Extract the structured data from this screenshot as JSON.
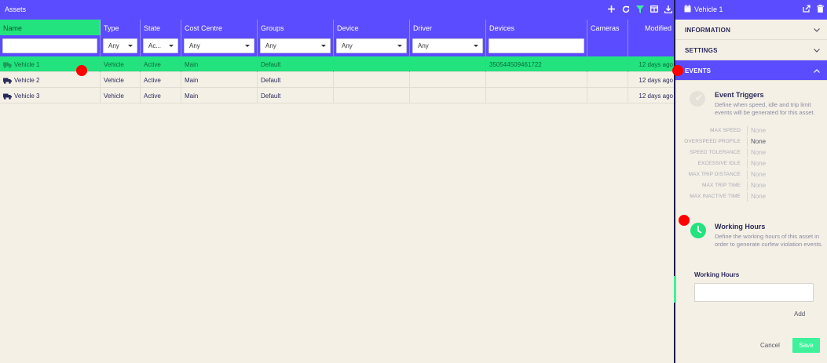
{
  "assets": {
    "title": "Assets",
    "columns": [
      "Name",
      "Type",
      "State",
      "Cost Centre",
      "Groups",
      "Device",
      "Driver",
      "Devices",
      "Cameras",
      "Modified"
    ],
    "filters": {
      "type": "Any",
      "state": "Ac...",
      "cost_centre": "Any",
      "groups": "Any",
      "device": "Any",
      "driver": "Any"
    },
    "rows": [
      {
        "name": "Vehicle 1",
        "type": "Vehicle",
        "state": "Active",
        "cost_centre": "Main",
        "groups": "Default",
        "device": "",
        "driver": "",
        "devices": "350544509461722",
        "cameras": "",
        "modified": "12 days ago"
      },
      {
        "name": "Vehicle 2",
        "type": "Vehicle",
        "state": "Active",
        "cost_centre": "Main",
        "groups": "Default",
        "device": "",
        "driver": "",
        "devices": "",
        "cameras": "",
        "modified": "12 days ago"
      },
      {
        "name": "Vehicle 3",
        "type": "Vehicle",
        "state": "Active",
        "cost_centre": "Main",
        "groups": "Default",
        "device": "",
        "driver": "",
        "devices": "",
        "cameras": "",
        "modified": "12 days ago"
      }
    ]
  },
  "detail": {
    "title": "Vehicle 1",
    "sections": {
      "information": "INFORMATION",
      "settings": "SETTINGS",
      "events": "EVENTS"
    },
    "event_triggers": {
      "title": "Event Triggers",
      "description": "Define when speed, idle and trip limit events will be generated for this asset.",
      "fields": [
        {
          "label": "MAX SPEED",
          "value": "None"
        },
        {
          "label": "OVERSPEED PROFILE",
          "value": "None"
        },
        {
          "label": "SPEED TOLERANCE",
          "value": "None"
        },
        {
          "label": "EXCESSIVE IDLE",
          "value": "None"
        },
        {
          "label": "MAX TRIP DISTANCE",
          "value": "None"
        },
        {
          "label": "MAX TRIP TIME",
          "value": "None"
        },
        {
          "label": "MAX INACTIVE TIME",
          "value": "None"
        }
      ]
    },
    "working_hours": {
      "title": "Working Hours",
      "description": "Define the working hours of this asset in order to generate curfew violation events.",
      "field_label": "Working Hours",
      "value": "",
      "add_label": "Add"
    },
    "cancel_label": "Cancel",
    "save_label": "Save"
  },
  "icons": {
    "topbar": [
      "plus-icon",
      "refresh-icon",
      "filter-icon",
      "columns-icon",
      "download-icon"
    ],
    "detail_header": [
      "calendar-icon",
      "export-icon",
      "trash-icon"
    ],
    "row": "truck-icon",
    "event_triggers": "speedometer-icon",
    "working_hours": "clock-icon"
  },
  "colors": {
    "primary": "#5b4cff",
    "selected": "#22e37e",
    "save": "#3df29a",
    "background": "#f5f0e6",
    "marker": "#ff0000"
  }
}
